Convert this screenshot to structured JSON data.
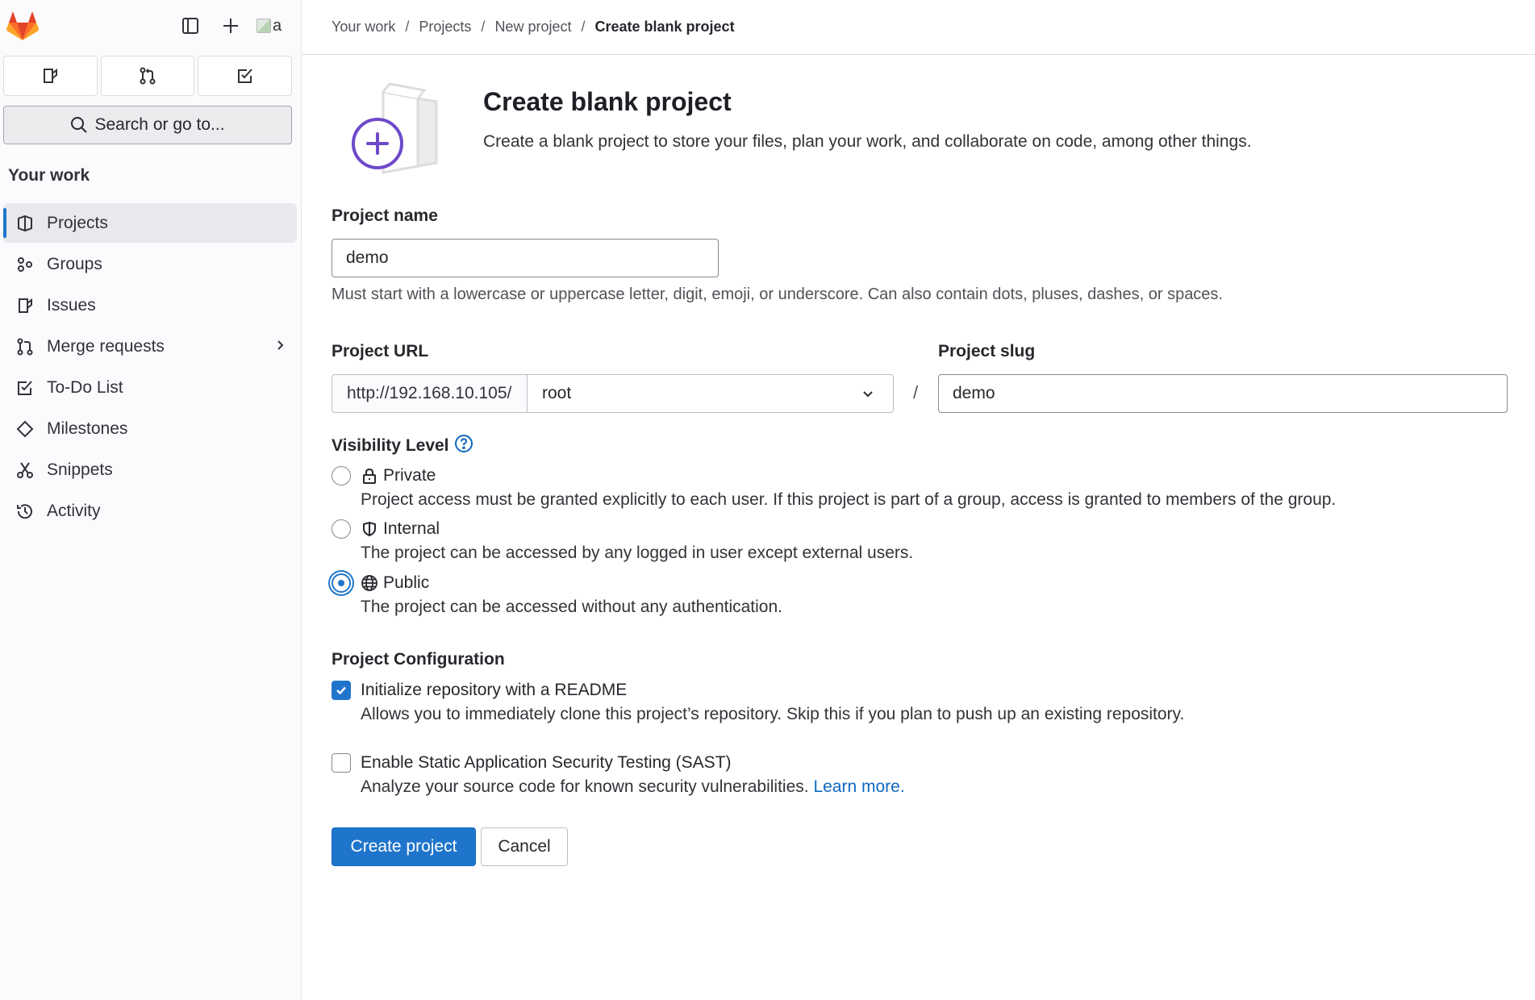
{
  "colors": {
    "accent": "#1f75cb",
    "link": "#1068bf",
    "logo_primary": "#e24329",
    "logo_secondary": "#fc6d26",
    "logo_tertiary": "#fca326",
    "illustration": "#6e49cb"
  },
  "sidebar": {
    "avatar_alt": "a",
    "top_icons": [
      "sidebar-toggle-icon",
      "plus-icon"
    ],
    "quick_actions": [
      "issues-icon",
      "merge-request-icon",
      "todo-icon"
    ],
    "search_label": "Search or go to...",
    "section_title": "Your work",
    "items": [
      {
        "label": "Projects",
        "icon": "project-icon"
      },
      {
        "label": "Groups",
        "icon": "group-icon"
      },
      {
        "label": "Issues",
        "icon": "issues-icon"
      },
      {
        "label": "Merge requests",
        "icon": "merge-request-icon"
      },
      {
        "label": "To-Do List",
        "icon": "todo-icon"
      },
      {
        "label": "Milestones",
        "icon": "milestone-icon"
      },
      {
        "label": "Snippets",
        "icon": "snippet-icon"
      },
      {
        "label": "Activity",
        "icon": "history-icon"
      }
    ]
  },
  "breadcrumb": [
    "Your work",
    "Projects",
    "New project",
    "Create blank project"
  ],
  "page": {
    "title": "Create blank project",
    "description": "Create a blank project to store your files, plan your work, and collaborate on code, among other things."
  },
  "form": {
    "project_name": {
      "label": "Project name",
      "value": "demo",
      "help": "Must start with a lowercase or uppercase letter, digit, emoji, or underscore. Can also contain dots, pluses, dashes, or spaces."
    },
    "project_url": {
      "label": "Project URL",
      "prefix": "http://192.168.10.105/",
      "namespace": "root"
    },
    "separator": "/",
    "project_slug": {
      "label": "Project slug",
      "value": "demo"
    },
    "visibility": {
      "label": "Visibility Level",
      "selected": "Public",
      "options": [
        {
          "label": "Private",
          "icon": "lock-icon",
          "desc": "Project access must be granted explicitly to each user. If this project is part of a group, access is granted to members of the group."
        },
        {
          "label": "Internal",
          "icon": "shield-icon",
          "desc": "The project can be accessed by any logged in user except external users."
        },
        {
          "label": "Public",
          "icon": "globe-icon",
          "desc": "The project can be accessed without any authentication."
        }
      ]
    },
    "config": {
      "label": "Project Configuration",
      "readme": {
        "label": "Initialize repository with a README",
        "desc": "Allows you to immediately clone this project’s repository. Skip this if you plan to push up an existing repository.",
        "checked": true
      },
      "sast": {
        "label": "Enable Static Application Security Testing (SAST)",
        "desc": "Analyze your source code for known security vulnerabilities.",
        "link": "Learn more.",
        "checked": false
      }
    },
    "buttons": {
      "create": "Create project",
      "cancel": "Cancel"
    }
  }
}
